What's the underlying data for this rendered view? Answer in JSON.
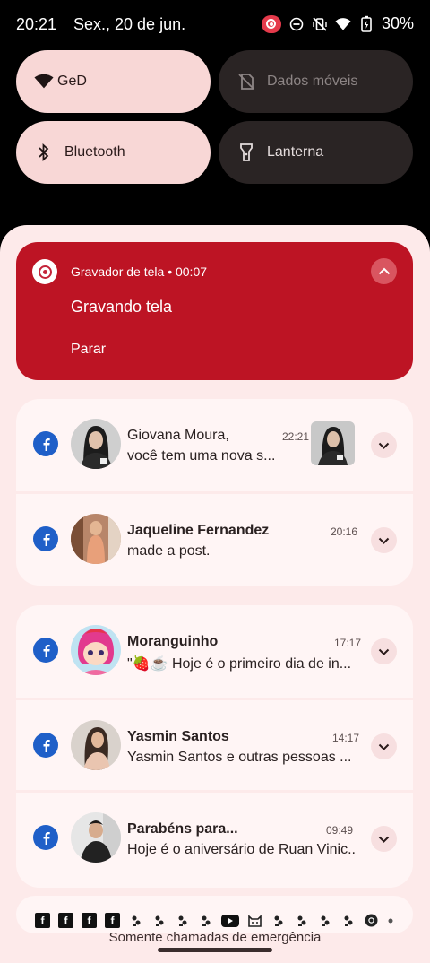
{
  "status_bar": {
    "time": "20:21",
    "date": "Sex., 20 de jun.",
    "battery": "30%",
    "icons": [
      "screen-record-icon",
      "do-not-disturb-icon",
      "vibrate-off-icon",
      "wifi-icon",
      "battery-icon"
    ]
  },
  "tiles": {
    "wifi": {
      "label": "GeD",
      "state": "on",
      "icon": "wifi-icon"
    },
    "data": {
      "label": "Dados móveis",
      "state": "off",
      "icon": "mobile-data-off-icon"
    },
    "bluetooth": {
      "label": "Bluetooth",
      "state": "on",
      "icon": "bluetooth-icon"
    },
    "flashlight": {
      "label": "Lanterna",
      "state": "off",
      "icon": "flashlight-icon"
    }
  },
  "recorder": {
    "app": "Gravador de tela",
    "elapsed": "00:07",
    "separator": "•",
    "title": "Gravando tela",
    "action": "Parar"
  },
  "notifications_group1": [
    {
      "sender": "Giovana Moura,",
      "time": "22:21",
      "text": "você tem uma nova s...",
      "bold": false
    },
    {
      "sender": "Jaqueline Fernandez",
      "time": "20:16",
      "text": "made a post.",
      "bold": true
    }
  ],
  "notifications_group2": [
    {
      "sender": "Moranguinho",
      "time": "17:17",
      "text": "\"🍓☕ Hoje é o primeiro dia de in...",
      "bold": true
    },
    {
      "sender": "Yasmin Santos",
      "time": "14:17",
      "text": "Yasmin Santos e outras pessoas ...",
      "bold": true
    },
    {
      "sender": "Parabéns para...",
      "time": "09:49",
      "text": "Hoje é o aniversário de Ruan Vinic...",
      "bold": true
    }
  ],
  "footer": {
    "emergency": "Somente chamadas de emergência",
    "fb_letter": "f",
    "app_icons": [
      "facebook-icon",
      "facebook-icon",
      "facebook-icon",
      "facebook-icon",
      "app-icon",
      "app-icon",
      "app-icon",
      "app-icon",
      "youtube-icon",
      "cat-icon",
      "app-icon",
      "app-icon",
      "app-icon",
      "app-icon",
      "chrome-icon",
      "more-dot-icon"
    ]
  },
  "colors": {
    "recorder_bg": "#bd1424",
    "shade_bg": "#fdeaea",
    "tile_on": "#f8d7d6",
    "tile_off": "#2a2424",
    "facebook_blue": "#1f5fc8"
  }
}
